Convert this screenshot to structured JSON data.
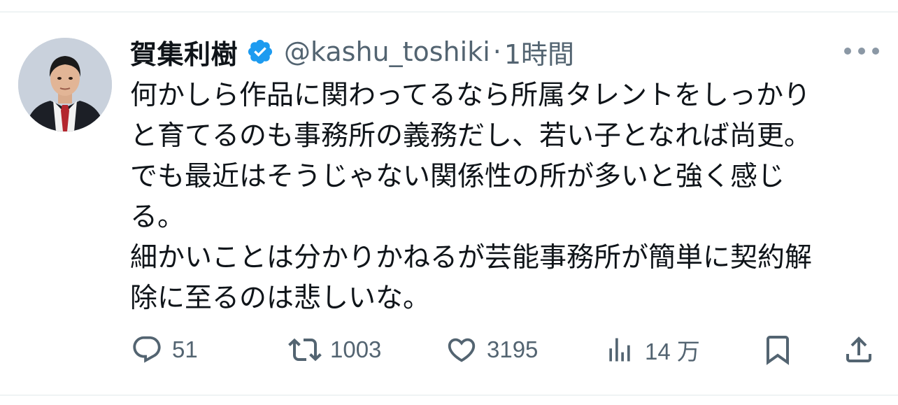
{
  "tweet": {
    "display_name": "賀集利樹",
    "handle": "@kashu_toshiki",
    "separator": "·",
    "time": "1時間",
    "verified": true,
    "text_lines": [
      "何かしら作品に関わってるなら所属タレントをしっかり",
      "と育てるのも事務所の義務だし、若い子となれば尚更。",
      "でも最近はそうじゃない関係性の所が多いと強く感じ",
      "る。",
      "細かいことは分かりかねるが芸能事務所が簡単に契約解",
      "除に至るのは悲しいな。"
    ]
  },
  "actions": {
    "reply_count": "51",
    "repost_count": "1003",
    "like_count": "3195",
    "views_count": "14 万"
  },
  "icons": {
    "verified": "verified-badge-icon",
    "more": "more-horizontal-icon",
    "reply": "reply-icon",
    "repost": "repost-icon",
    "like": "heart-icon",
    "views": "views-icon",
    "bookmark": "bookmark-icon",
    "share": "share-icon"
  },
  "colors": {
    "verified_blue": "#1d9bf0",
    "secondary_text": "#536471",
    "primary_text": "#0f1419"
  }
}
